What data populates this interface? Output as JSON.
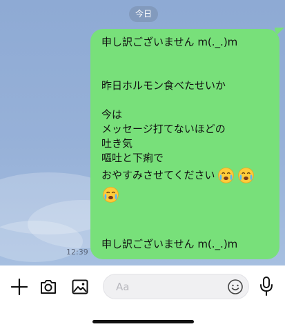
{
  "chat": {
    "date_label": "今日",
    "timestamp": "12:39",
    "message": {
      "line1": "申し訳ございません m(._.)m",
      "line2": "昨日ホルモン食べたせいか",
      "line3": "今は",
      "line4": "メッセージ打てないほどの",
      "line5": "吐き気",
      "line6": "嘔吐と下痢で",
      "line7": "おやすみさせてください",
      "line8": "申し訳ございません m(._.)m",
      "emoji": "crying-face-emoji"
    }
  },
  "composer": {
    "placeholder": "Aa",
    "icons": [
      "plus-icon",
      "camera-icon",
      "image-icon",
      "smiley-icon",
      "microphone-icon"
    ]
  },
  "colors": {
    "bubble": "#78e07a",
    "chat_background": "#97b1d8"
  }
}
